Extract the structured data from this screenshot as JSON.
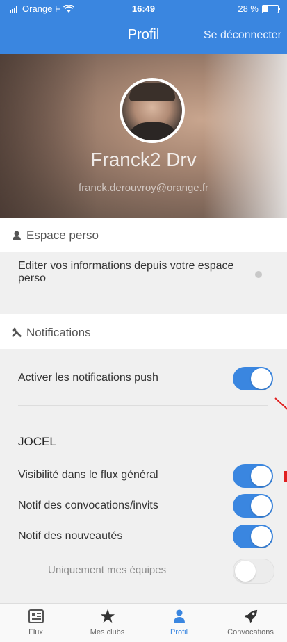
{
  "status_bar": {
    "carrier": "Orange F",
    "time": "16:49",
    "battery": "28 %",
    "battery_level": 0.28
  },
  "nav": {
    "title": "Profil",
    "logout": "Se déconnecter"
  },
  "profile": {
    "name": "Franck2 Drv",
    "email": "franck.derouvroy@orange.fr"
  },
  "sections": {
    "espace": {
      "title": "Espace perso",
      "icon": "user-icon",
      "edit_text": "Editer vos informations depuis votre espace perso"
    },
    "notifications": {
      "title": "Notifications",
      "icon": "tools-icon"
    }
  },
  "settings": {
    "push": {
      "label": "Activer les notifications push",
      "enabled": true
    },
    "club_name": "JOCEL",
    "club_items": [
      {
        "label": "Visibilité dans le flux général",
        "enabled": true
      },
      {
        "label": "Notif des convocations/invits",
        "enabled": true
      },
      {
        "label": "Notif des nouveautés",
        "enabled": true
      },
      {
        "label": "Uniquement mes équipes",
        "enabled": false
      }
    ]
  },
  "tabs": [
    {
      "label": "Flux",
      "icon": "newspaper-icon"
    },
    {
      "label": "Mes clubs",
      "icon": "star-icon"
    },
    {
      "label": "Profil",
      "icon": "person-icon",
      "active": true
    },
    {
      "label": "Convocations",
      "icon": "rocket-icon"
    }
  ],
  "colors": {
    "accent": "#3a86e0",
    "annotation": "#e02020"
  }
}
